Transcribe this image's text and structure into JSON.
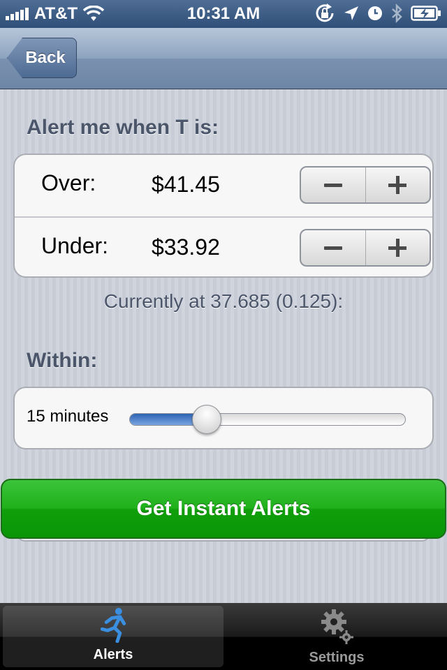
{
  "status_bar": {
    "carrier": "AT&T",
    "time": "10:31 AM",
    "icons": [
      "signal-icon",
      "wifi-icon",
      "rotation-lock-icon",
      "location-icon",
      "alarm-icon",
      "bluetooth-icon",
      "battery-icon"
    ]
  },
  "nav": {
    "back_label": "Back"
  },
  "alert_section": {
    "title": "Alert me when T is:",
    "rows": [
      {
        "label": "Over:",
        "value": "$41.45"
      },
      {
        "label": "Under:",
        "value": "$33.92"
      }
    ]
  },
  "current_text": "Currently at 37.685 (0.125):",
  "within_section": {
    "title": "Within:",
    "slider_label": "15 minutes",
    "slider_fraction": 0.28
  },
  "cta_label": "Get Instant Alerts",
  "tabs": [
    {
      "label": "Alerts",
      "icon": "running-man-icon",
      "active": true
    },
    {
      "label": "Settings",
      "icon": "gears-icon",
      "active": false
    }
  ],
  "colors": {
    "status_bar": "#3f5e88",
    "accent_green": "#20b11c",
    "slider_blue": "#2f63b3",
    "tab_active_icon": "#3a8fe0"
  }
}
